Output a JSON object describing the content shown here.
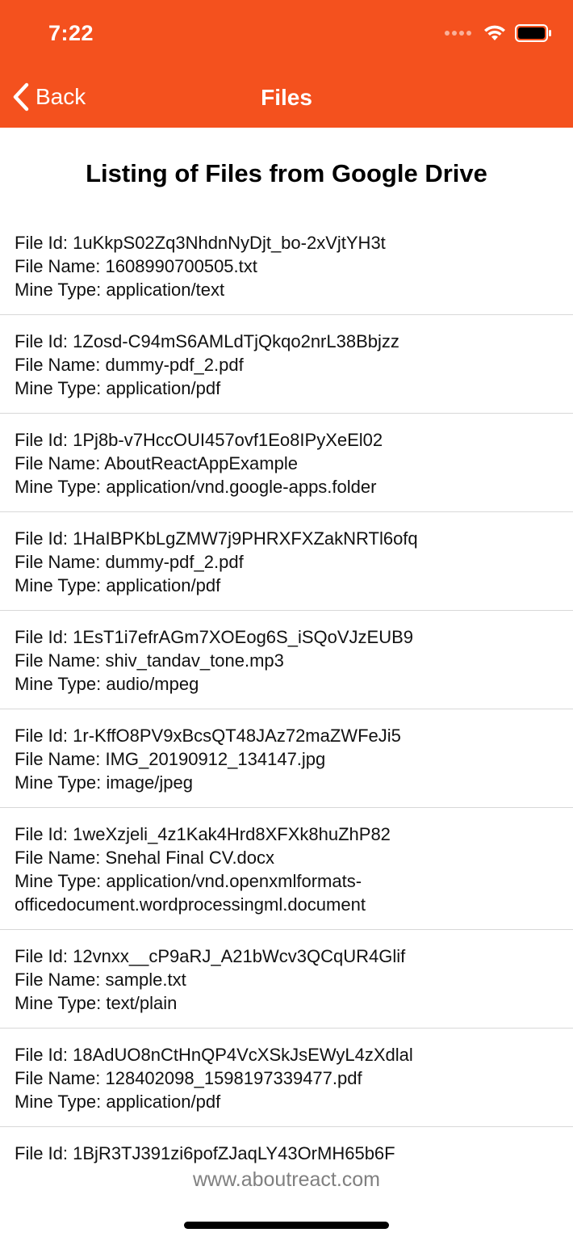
{
  "status_bar": {
    "time": "7:22"
  },
  "nav": {
    "back_label": "Back",
    "title": "Files"
  },
  "heading": "Listing of Files from Google Drive",
  "labels": {
    "file_id": "File Id: ",
    "file_name": "File Name: ",
    "mime_type": "Mine Type: "
  },
  "files": [
    {
      "id": "1uKkpS02Zq3NhdnNyDjt_bo-2xVjtYH3t",
      "name": "1608990700505.txt",
      "mime": "application/text"
    },
    {
      "id": "1Zosd-C94mS6AMLdTjQkqo2nrL38Bbjzz",
      "name": "dummy-pdf_2.pdf",
      "mime": "application/pdf"
    },
    {
      "id": "1Pj8b-v7HccOUI457ovf1Eo8IPyXeEl02",
      "name": "AboutReactAppExample",
      "mime": "application/vnd.google-apps.folder"
    },
    {
      "id": "1HaIBPKbLgZMW7j9PHRXFXZakNRTl6ofq",
      "name": "dummy-pdf_2.pdf",
      "mime": "application/pdf"
    },
    {
      "id": "1EsT1i7efrAGm7XOEog6S_iSQoVJzEUB9",
      "name": "shiv_tandav_tone.mp3",
      "mime": "audio/mpeg"
    },
    {
      "id": "1r-KffO8PV9xBcsQT48JAz72maZWFeJi5",
      "name": "IMG_20190912_134147.jpg",
      "mime": "image/jpeg"
    },
    {
      "id": "1weXzjeli_4z1Kak4Hrd8XFXk8huZhP82",
      "name": "Snehal Final CV.docx",
      "mime": "application/vnd.openxmlformats-officedocument.wordprocessingml.document"
    },
    {
      "id": "12vnxx__cP9aRJ_A21bWcv3QCqUR4Glif",
      "name": "sample.txt",
      "mime": "text/plain"
    },
    {
      "id": "18AdUO8nCtHnQP4VcXSkJsEWyL4zXdlal",
      "name": "128402098_1598197339477.pdf",
      "mime": "application/pdf"
    },
    {
      "id": "1BjR3TJ391zi6pofZJaqLY43OrMH65b6F",
      "name": "",
      "mime": ""
    }
  ],
  "footer": {
    "link_text": "www.aboutreact.com"
  },
  "colors": {
    "header_bg": "#f4511e",
    "header_text": "#ffffff",
    "footer_text": "#808080",
    "divider": "#d8d8d8"
  },
  "icons": {
    "back": "chevron-left-icon",
    "signal": "cellular-signal-icon",
    "wifi": "wifi-icon",
    "battery": "battery-icon"
  }
}
